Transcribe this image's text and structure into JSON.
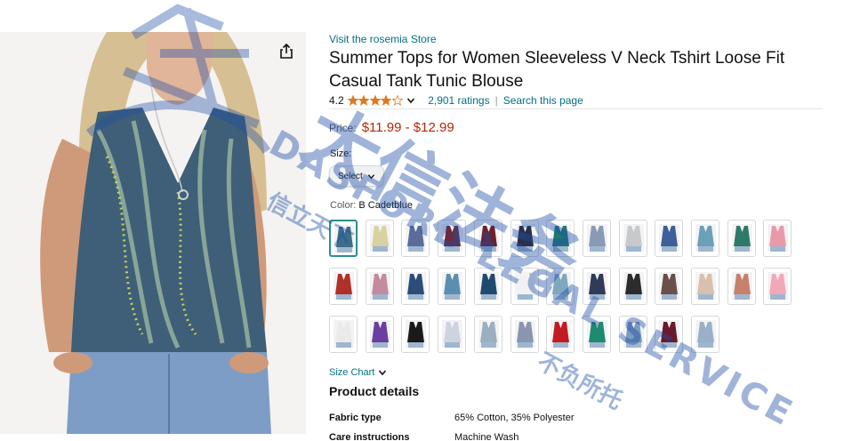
{
  "product": {
    "store_link": "Visit the rosemia Store",
    "title": "Summer Tops for Women Sleeveless V Neck Tshirt Loose Fit Casual Tank Tunic Blouse",
    "rating": "4.2",
    "stars_filled": 4.2,
    "ratings_count": "2,901 ratings",
    "separator": "|",
    "search_page": "Search this page",
    "price_label": "Price:",
    "price_range": "$11.99 - $12.99",
    "size_label": "Size:",
    "size_select": "Select",
    "color_label": "Color:",
    "color_value": "B Cadetblue",
    "size_chart": "Size Chart",
    "details_title": "Product details",
    "details": [
      {
        "key": "Fabric type",
        "value": "65% Cotton, 35% Polyester"
      },
      {
        "key": "Care instructions",
        "value": "Machine Wash"
      }
    ]
  },
  "icons": {
    "share": "share-icon",
    "star": "star-icon",
    "chevron": "chevron-down-icon"
  },
  "swatch_colors": [
    [
      "#3d6f86",
      "#d8d2a0",
      "#5a6c9a",
      "#6a2a3e",
      "#6e1f28",
      "#2b2f4a",
      "#1e7a6e",
      "#8a9ab5",
      "#c7c9cb",
      "#3f5f9a",
      "#6aa0b8",
      "#2e7a6a",
      "#e99aa8"
    ],
    [
      "#b0302a",
      "#c48aa0",
      "#2c4d7a",
      "#5b8fb0",
      "#1f4a6e",
      "#f1f1f1",
      "#7fa7bf",
      "#2f3b58",
      "#2c2c2c",
      "#6a4f4a",
      "#d9bfae",
      "#c7806a",
      "#f2a8b8"
    ],
    [
      "#eaeaea",
      "#6a3fa0",
      "#1a1a1a",
      "#cfd3e0",
      "#9ab0c0",
      "#8a96b0",
      "#c21a22",
      "#1f8a70",
      "#7a9abf",
      "#6a1a2a",
      "#9ab0c8"
    ]
  ],
  "watermark": {
    "cn_main": "大信法务",
    "en": "DASFORD LEGAL SERVICE",
    "cn_small": "信立天下",
    "cn_tail": "不负所托"
  },
  "colors": {
    "link": "#007185",
    "price": "#b12704",
    "star": "#de7921",
    "watermark": "#1e4ea8",
    "selected_border": "#2a8e8a"
  }
}
